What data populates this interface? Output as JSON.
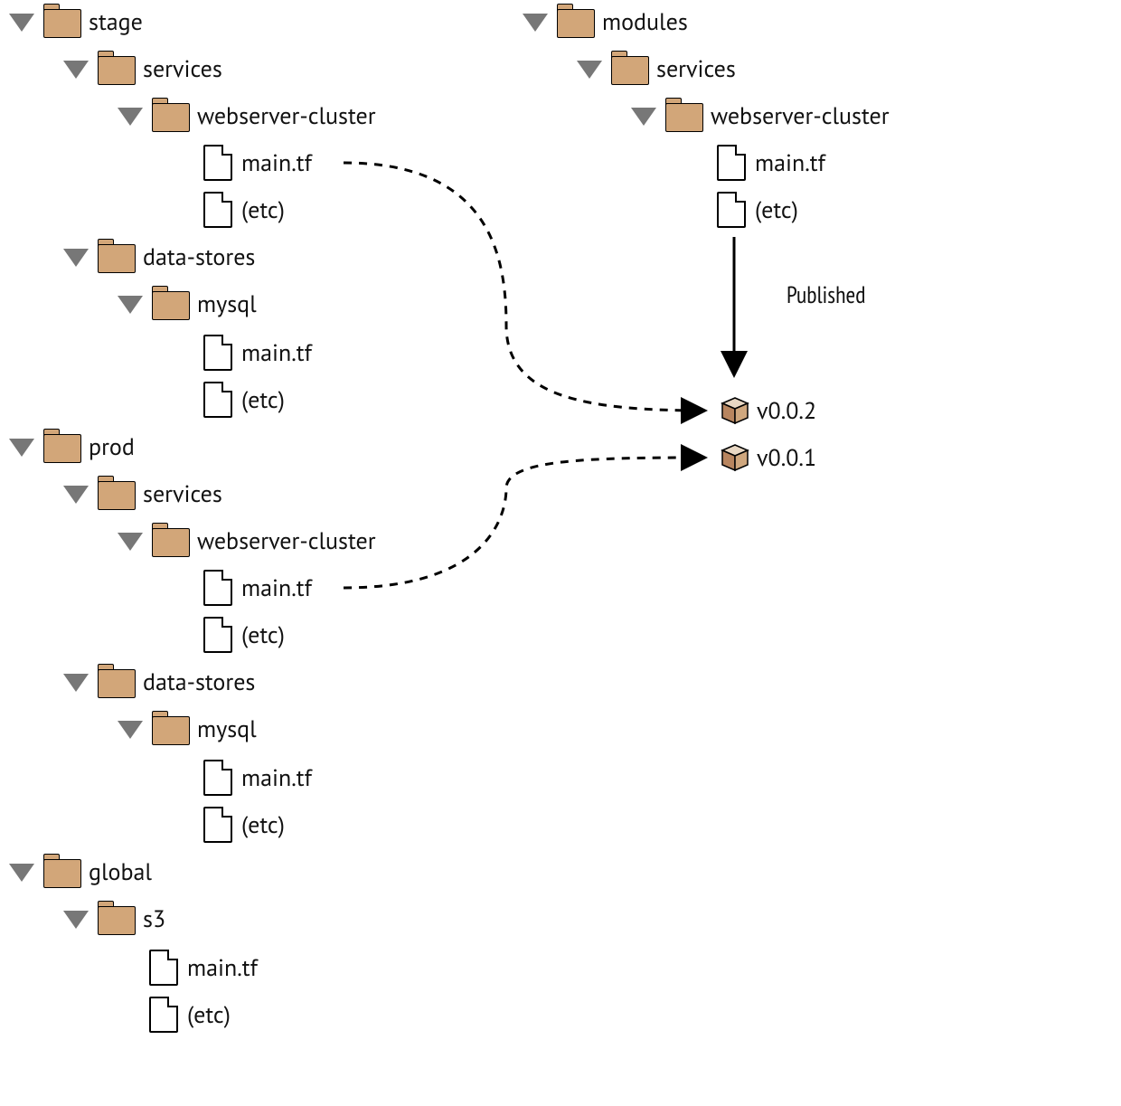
{
  "leftTree": {
    "stage": {
      "label": "stage",
      "services": {
        "label": "services",
        "webserverCluster": {
          "label": "webserver-cluster",
          "mainTf": "main.tf",
          "etc": "(etc)"
        }
      },
      "dataStores": {
        "label": "data-stores",
        "mysql": {
          "label": "mysql",
          "mainTf": "main.tf",
          "etc": "(etc)"
        }
      }
    },
    "prod": {
      "label": "prod",
      "services": {
        "label": "services",
        "webserverCluster": {
          "label": "webserver-cluster",
          "mainTf": "main.tf",
          "etc": "(etc)"
        }
      },
      "dataStores": {
        "label": "data-stores",
        "mysql": {
          "label": "mysql",
          "mainTf": "main.tf",
          "etc": "(etc)"
        }
      }
    },
    "global": {
      "label": "global",
      "s3": {
        "label": "s3",
        "mainTf": "main.tf",
        "etc": "(etc)"
      }
    }
  },
  "rightTree": {
    "modules": {
      "label": "modules",
      "services": {
        "label": "services",
        "webserverCluster": {
          "label": "webserver-cluster",
          "mainTf": "main.tf",
          "etc": "(etc)"
        }
      }
    }
  },
  "publishedLabel": "Published",
  "versions": {
    "v2": "v0.0.2",
    "v1": "v0.0.1"
  }
}
